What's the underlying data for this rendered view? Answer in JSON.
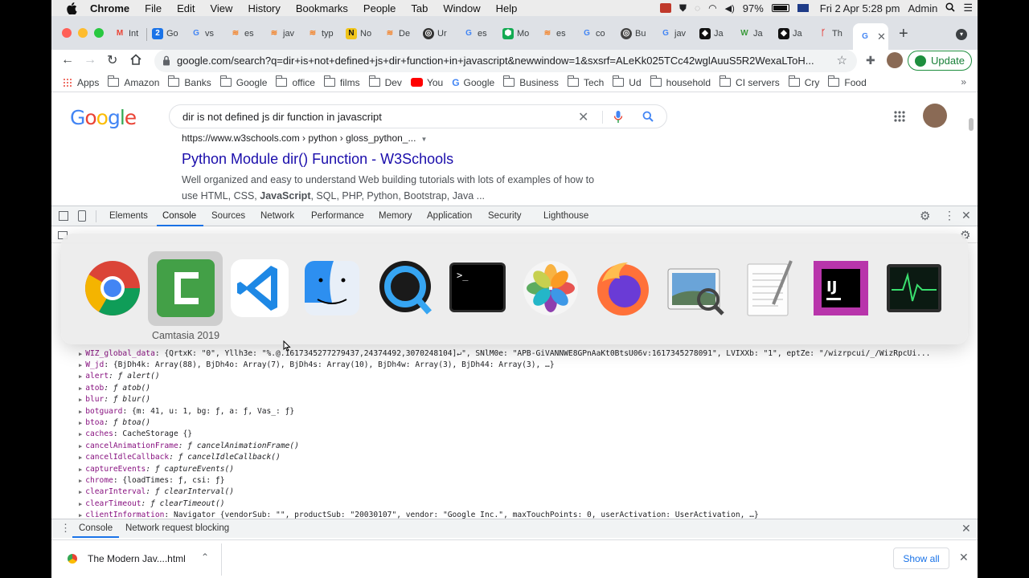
{
  "menubar": {
    "items": [
      "Chrome",
      "File",
      "Edit",
      "View",
      "History",
      "Bookmarks",
      "People",
      "Tab",
      "Window",
      "Help"
    ],
    "battery": "97%",
    "datetime": "Fri 2 Apr  5:28 pm",
    "user": "Admin"
  },
  "tabs": {
    "titles": [
      "Int",
      "Go",
      "vs",
      "es",
      "jav",
      "typ",
      "No",
      "De",
      "Ur",
      "es",
      "Mo",
      "es",
      "co",
      "Bu",
      "jav",
      "Ja",
      "Ja",
      "Ja",
      "Th"
    ]
  },
  "address_bar": {
    "url": "google.com/search?q=dir+is+not+defined+js+dir+function+in+javascript&newwindow=1&sxsrf=ALeKk025TCc42wglAuuS5R2WexaLToH...",
    "update_label": "Update"
  },
  "bookmarks": [
    "Apps",
    "Amazon",
    "Banks",
    "Google",
    "office",
    "films",
    "Dev",
    "You",
    "Google",
    "Business",
    "Tech",
    "Ud",
    "household",
    "CI servers",
    "Cry",
    "Food"
  ],
  "google": {
    "logo": "Google",
    "query": "dir is not defined js dir function in javascript",
    "result_url": "https://www.w3schools.com › python › gloss_python_...",
    "result_title": "Python Module dir() Function - W3Schools",
    "result_snippet_1": "Well organized and easy to understand Web building tutorials with lots of examples of how to",
    "result_snippet_2_pre": "use HTML, CSS, ",
    "result_snippet_2_bold": "JavaScript",
    "result_snippet_2_post": ", SQL, PHP, Python, Bootstrap, Java ..."
  },
  "devtools": {
    "tabs": [
      "Elements",
      "Console",
      "Sources",
      "Network",
      "Performance",
      "Memory",
      "Application",
      "Security",
      "Lighthouse"
    ],
    "active_tab": "Console",
    "drawer_tabs": [
      "Console",
      "Network request blocking"
    ],
    "console_lines": [
      {
        "key": "WIZ_global_data",
        "val": ": {QrtxK: \"0\", Yllh3e: \"%.@.1617345277279437,24374492,3070248104]↵\", SNlM0e: \"APB-GiVANNWE8GPnAaKt0BtsU06v:1617345278091\", LVIXXb: \"1\", eptZe: \"/wizrpcui/_/WizRpcUi..."
      },
      {
        "key": "W_jd",
        "val": ": {BjDh4k: Array(88), BjDh4o: Array(7), BjDh4s: Array(10), BjDh4w: Array(3), BjDh44: Array(3), …}"
      },
      {
        "key": "alert",
        "val": ": ƒ alert()"
      },
      {
        "key": "atob",
        "val": ": ƒ atob()"
      },
      {
        "key": "blur",
        "val": ": ƒ blur()"
      },
      {
        "key": "botguard",
        "val": ": {m: 41, u: 1, bg: ƒ, a: ƒ, Vas_: ƒ}"
      },
      {
        "key": "btoa",
        "val": ": ƒ btoa()"
      },
      {
        "key": "caches",
        "val": ": CacheStorage {}"
      },
      {
        "key": "cancelAnimationFrame",
        "val": ": ƒ cancelAnimationFrame()"
      },
      {
        "key": "cancelIdleCallback",
        "val": ": ƒ cancelIdleCallback()"
      },
      {
        "key": "captureEvents",
        "val": ": ƒ captureEvents()"
      },
      {
        "key": "chrome",
        "val": ": {loadTimes: ƒ, csi: ƒ}"
      },
      {
        "key": "clearInterval",
        "val": ": ƒ clearInterval()"
      },
      {
        "key": "clearTimeout",
        "val": ": ƒ clearTimeout()"
      },
      {
        "key": "clientInformation",
        "val": ": Navigator {vendorSub: \"\", productSub: \"20030107\", vendor: \"Google Inc.\", maxTouchPoints: 0, userActivation: UserActivation, …}"
      }
    ]
  },
  "download": {
    "filename": "The Modern Jav....html",
    "show_all": "Show all"
  },
  "app_switcher": {
    "apps": [
      "Google Chrome",
      "Camtasia 2019",
      "Visual Studio Code",
      "Finder",
      "QuickTime Player",
      "Terminal",
      "Photos",
      "Firefox",
      "Preview",
      "TextEdit",
      "IntelliJ IDEA",
      "Activity Monitor"
    ],
    "selected_label": "Camtasia 2019"
  },
  "colors": {
    "google_blue": "#4285f4",
    "google_red": "#ea4335",
    "google_yellow": "#fbbc05",
    "google_green": "#34a853",
    "link": "#1a0dab",
    "devtools_accent": "#1a73e8"
  }
}
